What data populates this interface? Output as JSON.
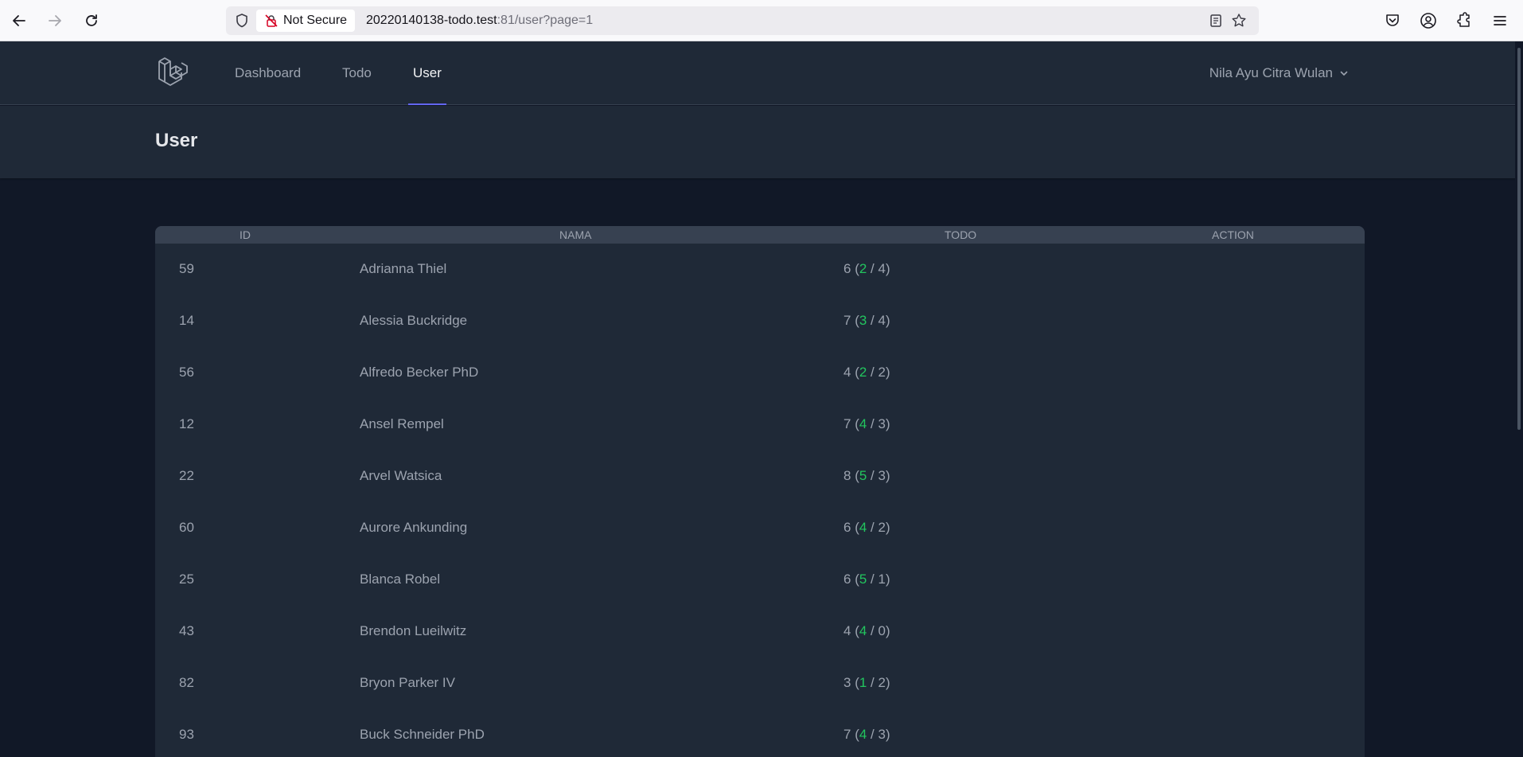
{
  "browser": {
    "security_label": "Not Secure",
    "url_host": "20220140138-todo.test",
    "url_rest": ":81/user?page=1"
  },
  "nav": {
    "links": [
      {
        "label": "Dashboard",
        "active": false
      },
      {
        "label": "Todo",
        "active": false
      },
      {
        "label": "User",
        "active": true
      }
    ],
    "user_name": "Nila Ayu Citra Wulan"
  },
  "page": {
    "title": "User"
  },
  "table": {
    "headers": {
      "id": "ID",
      "name": "NAMA",
      "todo": "TODO",
      "action": "ACTION"
    },
    "rows": [
      {
        "id": "59",
        "name": "Adrianna Thiel",
        "total": "6",
        "done": "2",
        "pending": "4"
      },
      {
        "id": "14",
        "name": "Alessia Buckridge",
        "total": "7",
        "done": "3",
        "pending": "4"
      },
      {
        "id": "56",
        "name": "Alfredo Becker PhD",
        "total": "4",
        "done": "2",
        "pending": "2"
      },
      {
        "id": "12",
        "name": "Ansel Rempel",
        "total": "7",
        "done": "4",
        "pending": "3"
      },
      {
        "id": "22",
        "name": "Arvel Watsica",
        "total": "8",
        "done": "5",
        "pending": "3"
      },
      {
        "id": "60",
        "name": "Aurore Ankunding",
        "total": "6",
        "done": "4",
        "pending": "2"
      },
      {
        "id": "25",
        "name": "Blanca Robel",
        "total": "6",
        "done": "5",
        "pending": "1"
      },
      {
        "id": "43",
        "name": "Brendon Lueilwitz",
        "total": "4",
        "done": "4",
        "pending": "0"
      },
      {
        "id": "82",
        "name": "Bryon Parker IV",
        "total": "3",
        "done": "1",
        "pending": "2"
      },
      {
        "id": "93",
        "name": "Buck Schneider PhD",
        "total": "7",
        "done": "4",
        "pending": "3"
      }
    ]
  },
  "colors": {
    "done_count": "#22c55e",
    "active_underline": "#6366f1"
  }
}
